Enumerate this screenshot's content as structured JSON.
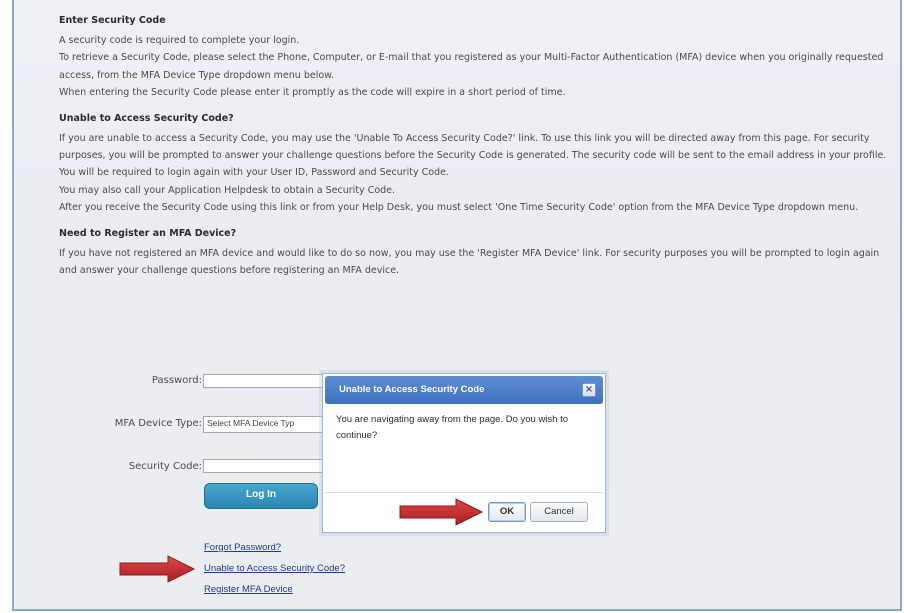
{
  "sections": {
    "enter": {
      "title": "Enter Security Code",
      "p1": "A security code is required to complete your login.",
      "p2": "To retrieve a Security Code, please select the Phone, Computer, or E-mail that you registered as your Multi-Factor Authentication (MFA) device when you originally requested access, from the MFA Device Type dropdown menu below.",
      "p3": "When entering the Security Code please enter it promptly as the code will expire in a short period of time."
    },
    "unable": {
      "title": "Unable to Access Security Code?",
      "p1": "If you are unable to access a Security Code, you may use the 'Unable To Access Security Code?' link. To use this link you will be directed away from this page. For security purposes, you will be prompted to answer your challenge questions before the Security Code is generated. The security code will be sent to the email address in your profile. You will be required to login again with your User ID, Password and Security Code.",
      "p2": "You may also call your Application Helpdesk to obtain a Security Code.",
      "p3": "After you receive the Security Code using this link or from your Help Desk, you must select 'One Time Security Code' option from the MFA Device Type dropdown menu."
    },
    "register": {
      "title": "Need to Register an MFA Device?",
      "p1": "If you have not registered an MFA device and would like to do so now, you may use the 'Register MFA Device' link. For security purposes you will be prompted to login again and answer your challenge questions before registering an MFA device."
    }
  },
  "form": {
    "password_label": "Password:",
    "mfa_label": "MFA Device Type:",
    "mfa_value": "Select MFA Device Typ",
    "code_label": "Security Code:",
    "login_button": "Log In"
  },
  "links": {
    "forgot": "Forgot Password?",
    "unable": "Unable to Access Security Code?",
    "register": "Register MFA Device"
  },
  "dialog": {
    "title": "Unable to Access Security Code",
    "message": "You are navigating away from the page. Do you wish to continue?",
    "ok": "OK",
    "cancel": "Cancel",
    "close_glyph": "×"
  },
  "colors": {
    "arrow": "#c0282a",
    "dialog_header": "#3e70c1",
    "login_button": "#2a86b3",
    "link": "#1c3c8c"
  },
  "icons": [
    "close-icon",
    "arrow-icon"
  ]
}
